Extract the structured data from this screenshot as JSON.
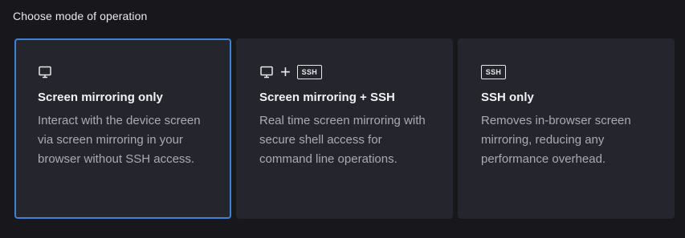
{
  "heading": "Choose mode of operation",
  "colors": {
    "background": "#17171c",
    "card": "#24252d",
    "selected_border": "#3d82d8"
  },
  "cards": [
    {
      "icons": [
        "monitor-icon"
      ],
      "title": "Screen mirroring only",
      "description": "Interact with the device screen via screen mirroring in your browser without SSH access.",
      "selected": true
    },
    {
      "icons": [
        "monitor-icon",
        "plus-icon",
        "ssh-icon"
      ],
      "ssh_label": "SSH",
      "plus": "+",
      "title": "Screen mirroring + SSH",
      "description": "Real time screen mirroring with secure shell access for command line operations.",
      "selected": false
    },
    {
      "icons": [
        "ssh-icon"
      ],
      "ssh_label": "SSH",
      "title": "SSH only",
      "description": "Removes in-browser screen mirroring, reducing any performance overhead.",
      "selected": false
    }
  ]
}
